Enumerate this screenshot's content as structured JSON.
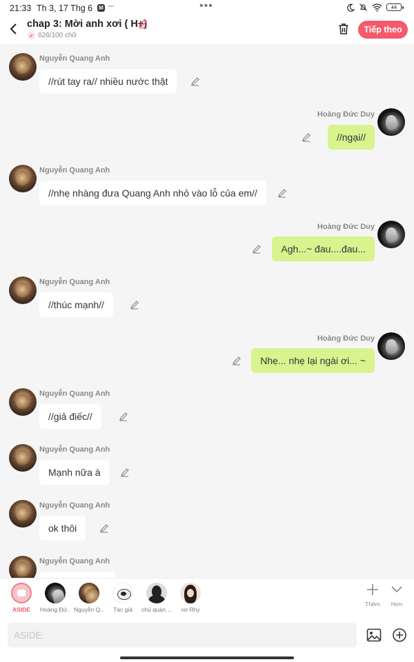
{
  "status_bar": {
    "time": "21:33",
    "date": "Th 3, 17 Thg 6",
    "more": "···",
    "center_dots": "•••",
    "battery": "44"
  },
  "header": {
    "title": "chap 3: Mời anh xơi ( H+)",
    "word_count": "626/100 chữ",
    "next_label": "Tiếp theo"
  },
  "messages": [
    {
      "author": "Nguyễn Quang Anh",
      "text": "//rút tay ra// nhiều nước thật",
      "side": "left"
    },
    {
      "author": "Hoàng Đức Duy",
      "text": "//ngại//",
      "side": "right"
    },
    {
      "author": "Nguyễn Quang Anh",
      "text": "//nhẹ nhàng đưa Quang Anh nhỏ vào lỗ của em//",
      "side": "left"
    },
    {
      "author": "Hoàng Đức Duy",
      "text": "Agh...~ đau....đau...",
      "side": "right"
    },
    {
      "author": "Nguyễn Quang Anh",
      "text": "//thúc mạnh//",
      "side": "left"
    },
    {
      "author": "Hoàng Đức Duy",
      "text": "Nhẹ... nhẹ lại ngài ơi... ~",
      "side": "right"
    },
    {
      "author": "Nguyễn Quang Anh",
      "text": "//giả điếc//",
      "side": "left"
    },
    {
      "author": "Nguyễn Quang Anh",
      "text": "Mạnh nữa à",
      "side": "left"
    },
    {
      "author": "Nguyễn Quang Anh",
      "text": "ok thôi",
      "side": "left"
    },
    {
      "author": "Nguyễn Quang Anh",
      "text": "",
      "side": "left"
    }
  ],
  "characters": [
    {
      "label": "ASIDE",
      "selected": true
    },
    {
      "label": "Hoàng Đứ..."
    },
    {
      "label": "Nguyễn Q..."
    },
    {
      "label": "Tác giả"
    },
    {
      "label": "chú quán ..."
    },
    {
      "label": "vợ Rhy"
    }
  ],
  "tools": {
    "add_label": "Thêm",
    "more_label": "Hơn"
  },
  "input": {
    "placeholder": "ASIDE:",
    "value": ""
  },
  "colors": {
    "accent": "#f4596c",
    "right_bubble": "#d7f48e",
    "left_bubble": "#ffffff",
    "background": "#f5f5f5"
  }
}
